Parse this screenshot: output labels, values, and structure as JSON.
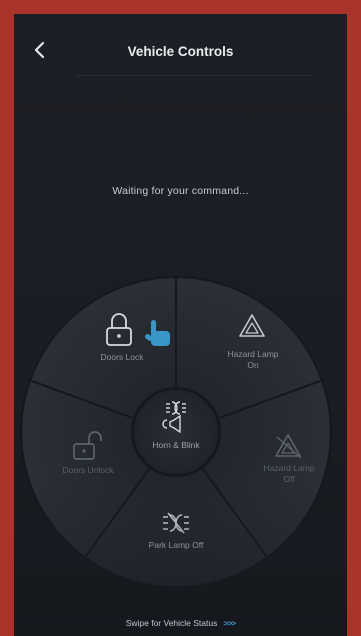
{
  "header": {
    "title": "Vehicle Controls",
    "back_icon": "chevron-left-icon"
  },
  "status_text": "Waiting for your command...",
  "controls": {
    "doors_lock": {
      "label": "Doors Lock",
      "icon": "padlock-closed-icon"
    },
    "hazard_on": {
      "label_line1": "Hazard Lamp",
      "label_line2": "On",
      "icon": "hazard-triangle-icon"
    },
    "hazard_off": {
      "label_line1": "Hazard Lamp",
      "label_line2": "Off",
      "icon": "hazard-triangle-icon"
    },
    "park_lamp_off": {
      "label": "Park Lamp Off",
      "icon": "park-lamp-icon"
    },
    "doors_unlock": {
      "label": "Doors Unlock",
      "icon": "padlock-open-icon"
    },
    "horn_blink": {
      "label": "Horn & Blink",
      "icon": "horn-lamp-icon"
    }
  },
  "footer": {
    "swipe_text": "Swipe for Vehicle Status",
    "arrows": ">>>"
  },
  "colors": {
    "accent": "#3a96c9",
    "background": "#1c1f25",
    "frame": "#a8342a"
  }
}
